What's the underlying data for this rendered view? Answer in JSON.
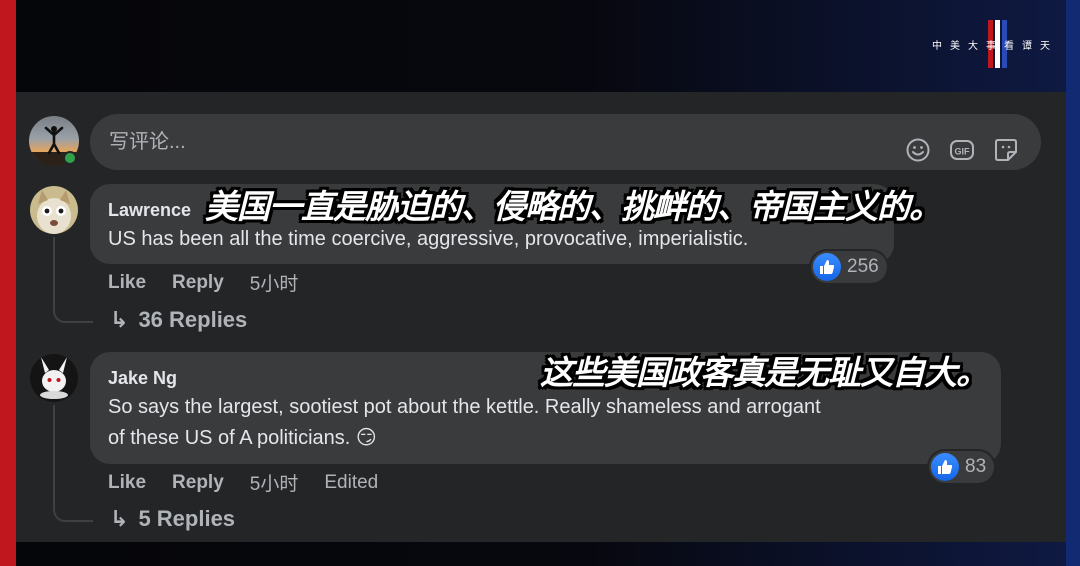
{
  "brand": {
    "text": "中美大事看谭天",
    "colors": [
      "#c0161d",
      "#ffffff",
      "#2a4bb5"
    ]
  },
  "composer": {
    "placeholder": "写评论...",
    "icons": [
      "emoji-icon",
      "gif-icon",
      "sticker-icon"
    ]
  },
  "comments": [
    {
      "author": "Lawrence",
      "text": "US has been all the time coercive, aggressive, provocative, imperialistic.",
      "reaction_count": "256",
      "actions": {
        "like": "Like",
        "reply": "Reply",
        "time": "5小时"
      },
      "replies_label": "36 Replies",
      "overlay_caption": "美国一直是胁迫的、侵略的、挑衅的、帝国主义的。"
    },
    {
      "author": "Jake Ng",
      "text_line1": "So says the largest, sootiest pot about the kettle. Really shameless and arrogant",
      "text_line2": "of these US of A politicians. 😏",
      "reaction_count": "83",
      "actions": {
        "like": "Like",
        "reply": "Reply",
        "time": "5小时",
        "edited": "Edited"
      },
      "replies_label": "5 Replies",
      "overlay_caption": "这些美国政客真是无耻又自大。"
    }
  ],
  "colors": {
    "panel": "#242526",
    "bubble": "#3a3b3c",
    "text": "#e4e6eb",
    "muted": "#b0b3b8",
    "like_blue": "#1877f2",
    "online_green": "#31a24c"
  }
}
